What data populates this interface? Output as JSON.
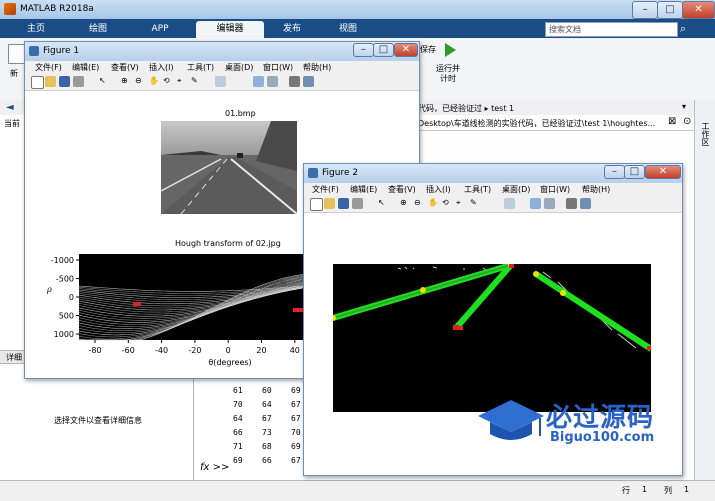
{
  "app": {
    "title": "MATLAB R2018a"
  },
  "ribbon": {
    "tabs": [
      "主页",
      "绘图",
      "APP",
      "编辑器",
      "发布",
      "视图"
    ],
    "active_tab": "编辑器",
    "search_placeholder": "搜索文档",
    "new_label": "新",
    "run_label": "运行并\n计时",
    "save_label": "保存"
  },
  "path": {
    "crumb": "代码，已经验证过  ▸  test 1",
    "editor_path": "Desktop\\车道线检测的实验代码，已经验证过\\test 1\\houghtes..."
  },
  "left": {
    "current_label": "当前",
    "details_label": "详细",
    "info": "选择文件以查看详细信息"
  },
  "workspace_label": "工作区",
  "code_rows": [
    [
      "61",
      "60",
      "69"
    ],
    [
      "70",
      "64",
      "67"
    ],
    [
      "64",
      "67",
      "67"
    ],
    [
      "66",
      "73",
      "70"
    ],
    [
      "71",
      "68",
      "69"
    ],
    [
      "69",
      "66",
      "67"
    ]
  ],
  "prompt": "fx >>",
  "status": {
    "row_label": "行",
    "row": "1",
    "col_label": "列",
    "col": "1"
  },
  "figure1": {
    "title": "Figure 1",
    "menu": [
      "文件(F)",
      "编辑(E)",
      "查看(V)",
      "插入(I)",
      "工具(T)",
      "桌面(D)",
      "窗口(W)",
      "帮助(H)"
    ],
    "image_title": "01.bmp",
    "hough": {
      "title": "Hough transform of 02.jpg",
      "xlabel": "θ(degrees)",
      "ylabel": "ρ",
      "xticks": [
        "-80",
        "-60",
        "-40",
        "-20",
        "0",
        "20",
        "40"
      ],
      "yticks": [
        "-1000",
        "-500",
        "0",
        "500",
        "1000"
      ]
    }
  },
  "figure2": {
    "title": "Figure 2",
    "menu": [
      "文件(F)",
      "编辑(E)",
      "查看(V)",
      "插入(I)",
      "工具(T)",
      "桌面(D)",
      "窗口(W)",
      "帮助(H)"
    ]
  },
  "watermark": {
    "brand": "必过源码",
    "url": "Biguo100.com"
  }
}
